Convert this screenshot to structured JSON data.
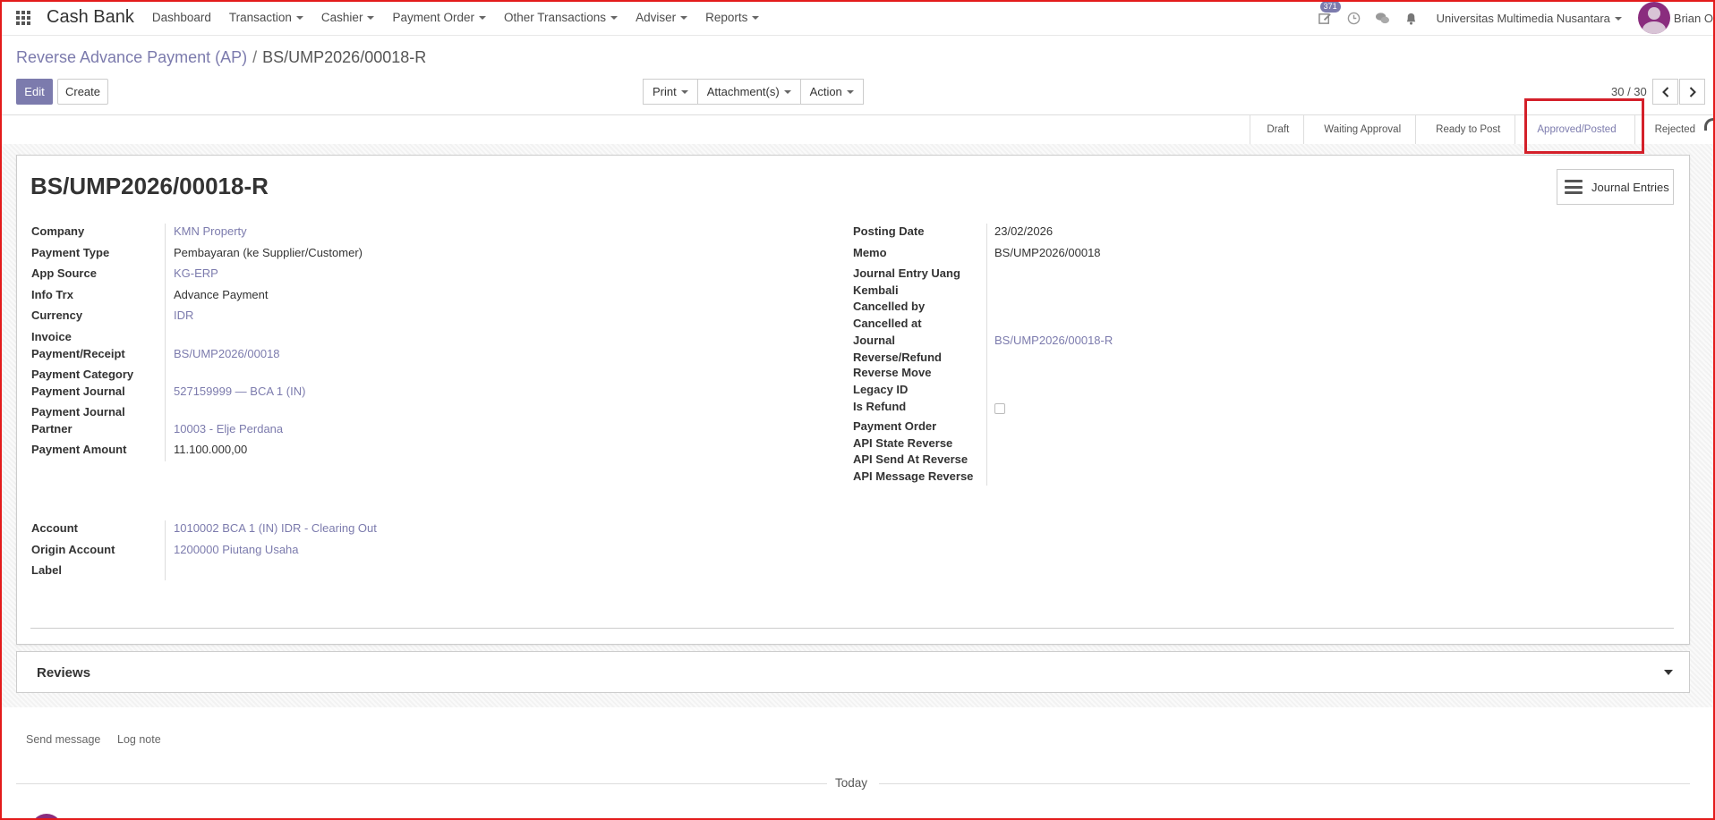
{
  "topnav": {
    "brand": "Cash Bank",
    "menu": [
      {
        "label": "Dashboard",
        "dropdown": false
      },
      {
        "label": "Transaction",
        "dropdown": true
      },
      {
        "label": "Cashier",
        "dropdown": true
      },
      {
        "label": "Payment Order",
        "dropdown": true
      },
      {
        "label": "Other Transactions",
        "dropdown": true
      },
      {
        "label": "Adviser",
        "dropdown": true
      },
      {
        "label": "Reports",
        "dropdown": true
      }
    ],
    "activity_badge": "371",
    "company": "Universitas Multimedia Nusantara",
    "user": "Brian O"
  },
  "breadcrumb": {
    "parent": "Reverse Advance Payment (AP)",
    "separator": "/",
    "current": "BS/UMP2026/00018-R"
  },
  "buttons": {
    "edit": "Edit",
    "create": "Create",
    "print": "Print",
    "attachments": "Attachment(s)",
    "action": "Action"
  },
  "pager": {
    "value": "30 / 30"
  },
  "statusbar": {
    "stages": [
      "Draft",
      "Waiting Approval",
      "Ready to Post",
      "Approved/Posted",
      "Rejected"
    ],
    "active": "Approved/Posted"
  },
  "record": {
    "title": "BS/UMP2026/00018-R",
    "journal_entries_button": "Journal Entries"
  },
  "left_fields": {
    "company": {
      "label": "Company",
      "value": "KMN Property"
    },
    "payment_type": {
      "label": "Payment Type",
      "value": "Pembayaran (ke Supplier/Customer)"
    },
    "app_source": {
      "label": "App Source",
      "value": "KG-ERP"
    },
    "info_trx": {
      "label": "Info Trx",
      "value": "Advance Payment"
    },
    "currency": {
      "label": "Currency",
      "value": "IDR"
    },
    "invoice": {
      "label": "Invoice Payment/Receipt",
      "value": "BS/UMP2026/00018"
    },
    "payment_category": {
      "label": "Payment Category",
      "value": ""
    },
    "payment_journal": {
      "label": "Payment Journal",
      "value": "527159999 — BCA 1 (IN)"
    },
    "payment_journal_partner": {
      "label": "Payment Journal Partner",
      "value": "10003 - Elje Perdana"
    },
    "payment_amount": {
      "label": "Payment Amount",
      "value": "11.100.000,00"
    }
  },
  "right_fields": {
    "posting_date": {
      "label": "Posting Date",
      "value": "23/02/2026"
    },
    "memo": {
      "label": "Memo",
      "value": "BS/UMP2026/00018"
    },
    "journal_entry_uang_kembali": {
      "label": "Journal Entry Uang Kembali",
      "value": ""
    },
    "cancelled_by": {
      "label": "Cancelled by",
      "value": ""
    },
    "cancelled_at": {
      "label": "Cancelled at",
      "value": ""
    },
    "journal_reverse_refund": {
      "label": "Journal Reverse/Refund",
      "value": "BS/UMP2026/00018-R"
    },
    "reverse_move": {
      "label": "Reverse Move",
      "value": ""
    },
    "legacy_id": {
      "label": "Legacy ID",
      "value": ""
    },
    "is_refund": {
      "label": "Is Refund",
      "checked": false
    },
    "payment_order": {
      "label": "Payment Order",
      "value": ""
    },
    "api_state_reverse": {
      "label": "API State Reverse",
      "value": ""
    },
    "api_send_at_reverse": {
      "label": "API Send At Reverse",
      "value": ""
    },
    "api_message_reverse": {
      "label": "API Message Reverse",
      "value": ""
    }
  },
  "account_fields": {
    "account": {
      "label": "Account",
      "value": "1010002 BCA 1 (IN) IDR - Clearing Out"
    },
    "origin_account": {
      "label": "Origin Account",
      "value": "1200000 Piutang Usaha"
    },
    "label": {
      "label": "Label",
      "value": ""
    }
  },
  "reviews": {
    "title": "Reviews"
  },
  "chatter": {
    "send_message": "Send message",
    "log_note": "Log note",
    "today": "Today"
  },
  "colors": {
    "accent": "#7c7bad",
    "highlight": "#d4202a"
  }
}
